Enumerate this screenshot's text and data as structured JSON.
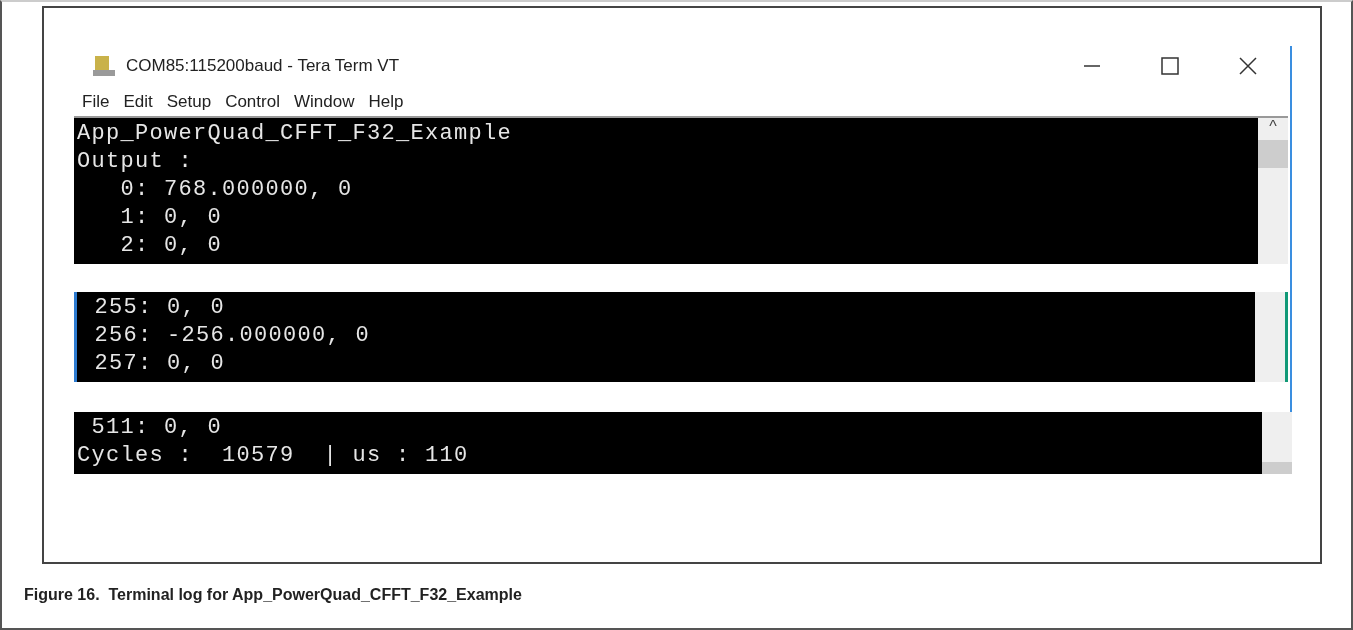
{
  "window": {
    "title": "COM85:115200baud - Tera Term VT"
  },
  "menu": [
    "File",
    "Edit",
    "Setup",
    "Control",
    "Window",
    "Help"
  ],
  "panels": [
    {
      "lines": [
        "App_PowerQuad_CFFT_F32_Example",
        "Output :",
        "   0: 768.000000, 0",
        "   1: 0, 0",
        "   2: 0, 0"
      ],
      "scroll_up": "^"
    },
    {
      "lines": [
        " 255: 0, 0",
        " 256: -256.000000, 0",
        " 257: 0, 0"
      ]
    },
    {
      "lines": [
        " 511: 0, 0",
        "Cycles :  10579  | us : 110"
      ]
    }
  ],
  "caption": "Figure 16.  Terminal log for App_PowerQuad_CFFT_F32_Example"
}
